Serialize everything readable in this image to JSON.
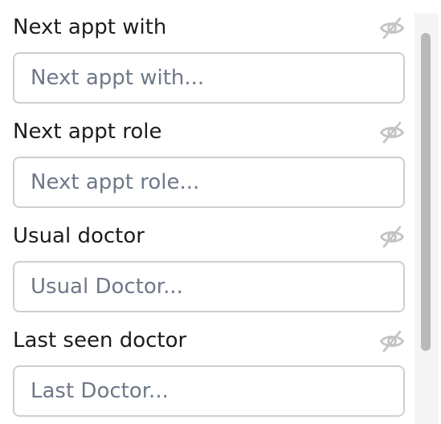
{
  "fields": [
    {
      "label": "Next appt with",
      "placeholder": "Next appt with...",
      "value": "",
      "visibility_icon": "eye-slash-icon"
    },
    {
      "label": "Next appt role",
      "placeholder": "Next appt role...",
      "value": "",
      "visibility_icon": "eye-slash-icon"
    },
    {
      "label": "Usual doctor",
      "placeholder": "Usual Doctor...",
      "value": "",
      "visibility_icon": "eye-slash-icon"
    },
    {
      "label": "Last seen doctor",
      "placeholder": "Last Doctor...",
      "value": "",
      "visibility_icon": "eye-slash-icon"
    }
  ],
  "colors": {
    "label_text": "#1c1c1c",
    "placeholder_text": "#6f7888",
    "input_border": "#cfcfcf",
    "icon": "#c4c4c4",
    "scrollbar_thumb": "#b9b9b9",
    "scrollbar_track": "#f4f4f4"
  }
}
